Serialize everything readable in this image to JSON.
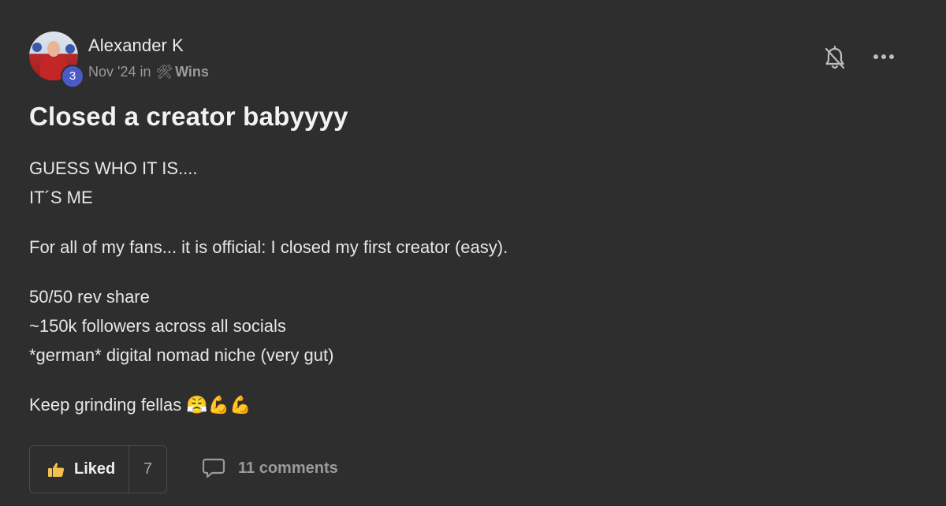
{
  "post": {
    "author": {
      "name": "Alexander K",
      "level": "3"
    },
    "meta": {
      "date": "Nov '24",
      "in_word": "in",
      "category_icon": "tools-icon",
      "category": "Wins"
    },
    "title": "Closed a creator babyyyy",
    "body": {
      "para1": [
        "GUESS WHO IT IS....",
        "IT´S ME"
      ],
      "para2": "For all of my fans... it is official: I closed my first creator (easy).",
      "para3": [
        "50/50 rev share",
        "~150k followers across all socials",
        "*german* digital nomad niche (very gut)"
      ],
      "para4": "Keep grinding fellas 😤💪💪"
    },
    "actions": {
      "like_label": "Liked",
      "like_count": "7",
      "comments_label": "11 comments"
    },
    "colors": {
      "background": "#2e2e2e",
      "level_badge": "#4a5bc7",
      "text_primary": "#e8e8e8",
      "text_muted": "#9a9a9a"
    }
  }
}
